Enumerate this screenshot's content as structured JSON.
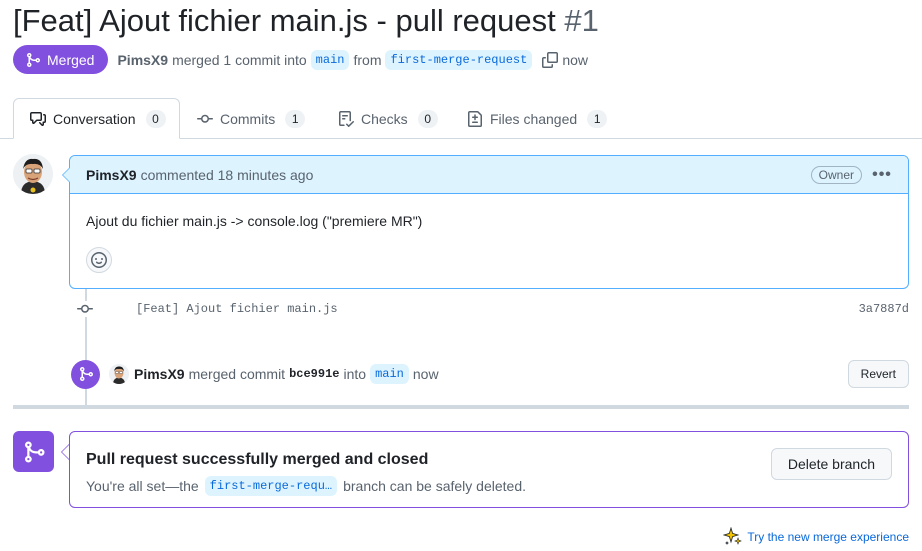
{
  "pr": {
    "title": "[Feat] Ajout fichier main.js - pull request",
    "number": "#1"
  },
  "status": {
    "badge_label": "Merged",
    "author": "PimsX9",
    "text_merged": "merged 1 commit into",
    "base_branch": "main",
    "text_from": "from",
    "head_branch": "first-merge-request",
    "time": "now"
  },
  "tabs": [
    {
      "label": "Conversation",
      "count": "0",
      "icon": "comment-discussion-icon"
    },
    {
      "label": "Commits",
      "count": "1",
      "icon": "git-commit-icon"
    },
    {
      "label": "Checks",
      "count": "0",
      "icon": "checklist-icon"
    },
    {
      "label": "Files changed",
      "count": "1",
      "icon": "file-diff-icon"
    }
  ],
  "comment": {
    "author": "PimsX9",
    "meta": "commented 18 minutes ago",
    "role": "Owner",
    "menu": "•••",
    "body": "Ajout du fichier main.js -> console.log (\"premiere MR\")"
  },
  "commit": {
    "message": "[Feat] Ajout fichier main.js",
    "sha": "3a7887d"
  },
  "merge_event": {
    "author": "PimsX9",
    "text_merged": "merged commit",
    "sha": "bce991e",
    "text_into": "into",
    "branch": "main",
    "time": "now",
    "revert_label": "Revert"
  },
  "merged_panel": {
    "title": "Pull request successfully merged and closed",
    "sub_before": "You're all set—the",
    "branch": "first-merge-requ…",
    "sub_after": "branch can be safely deleted.",
    "delete_label": "Delete branch"
  },
  "footer": {
    "try_label": "Try the new merge experience"
  },
  "colors": {
    "merged_purple": "#8250df",
    "link_blue": "#0969da",
    "comment_header_bg": "#ddf4ff",
    "border": "#d1d9e0"
  }
}
